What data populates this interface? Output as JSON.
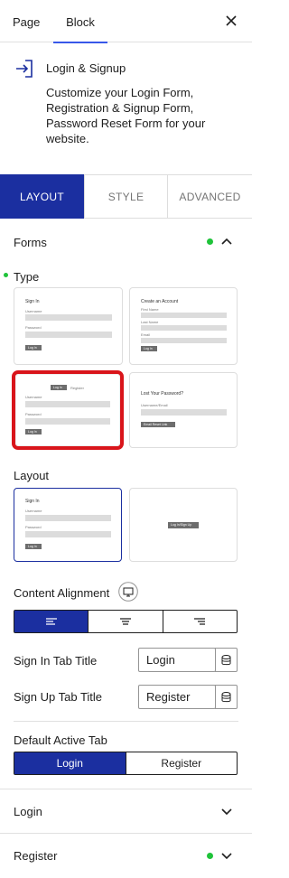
{
  "top_tabs": {
    "page": "Page",
    "block": "Block"
  },
  "block": {
    "title": "Login & Signup",
    "description": "Customize your Login Form, Registration & Signup Form, Password Reset Form for your website."
  },
  "section_tabs": {
    "layout": "LAYOUT",
    "style": "STYLE",
    "advanced": "ADVANCED"
  },
  "forms_panel": {
    "title": "Forms",
    "type_label": "Type",
    "type_cards": [
      {
        "title": "Sign In",
        "field1": "Username",
        "field2": "Password",
        "button": "Log In"
      },
      {
        "title": "Create an Account",
        "field1": "First Name",
        "field2": "Last Name",
        "field3": "Email",
        "button": "Log In"
      },
      {
        "tab1": "Log In",
        "tab2": "Register",
        "field1": "Username",
        "field2": "Password",
        "button": "Log In"
      },
      {
        "title": "Lost Your Password?",
        "field1": "Username/Email",
        "button": "Email Reset Link"
      }
    ],
    "layout_label": "Layout",
    "layout_cards": [
      {
        "title": "Sign In",
        "field1": "Username",
        "field2": "Password",
        "button": "Log In"
      },
      {
        "button": "Log In/Sign Up"
      }
    ],
    "content_alignment_label": "Content Alignment",
    "sign_in_tab_title_label": "Sign In Tab Title",
    "sign_in_tab_title_value": "Login",
    "sign_up_tab_title_label": "Sign Up Tab Title",
    "sign_up_tab_title_value": "Register",
    "default_active_tab_label": "Default Active Tab",
    "default_active_tab_options": [
      "Login",
      "Register"
    ]
  },
  "collapsed_panels": {
    "login": "Login",
    "register": "Register"
  },
  "colors": {
    "accent": "#1b2fa0",
    "indicator": "#1fc33a",
    "highlight": "#d9151b"
  },
  "icons": [
    "close-icon",
    "login-icon",
    "chevron-up-icon",
    "chevron-down-icon",
    "desktop-icon",
    "database-icon",
    "align-left-icon",
    "align-center-icon",
    "align-right-icon"
  ]
}
